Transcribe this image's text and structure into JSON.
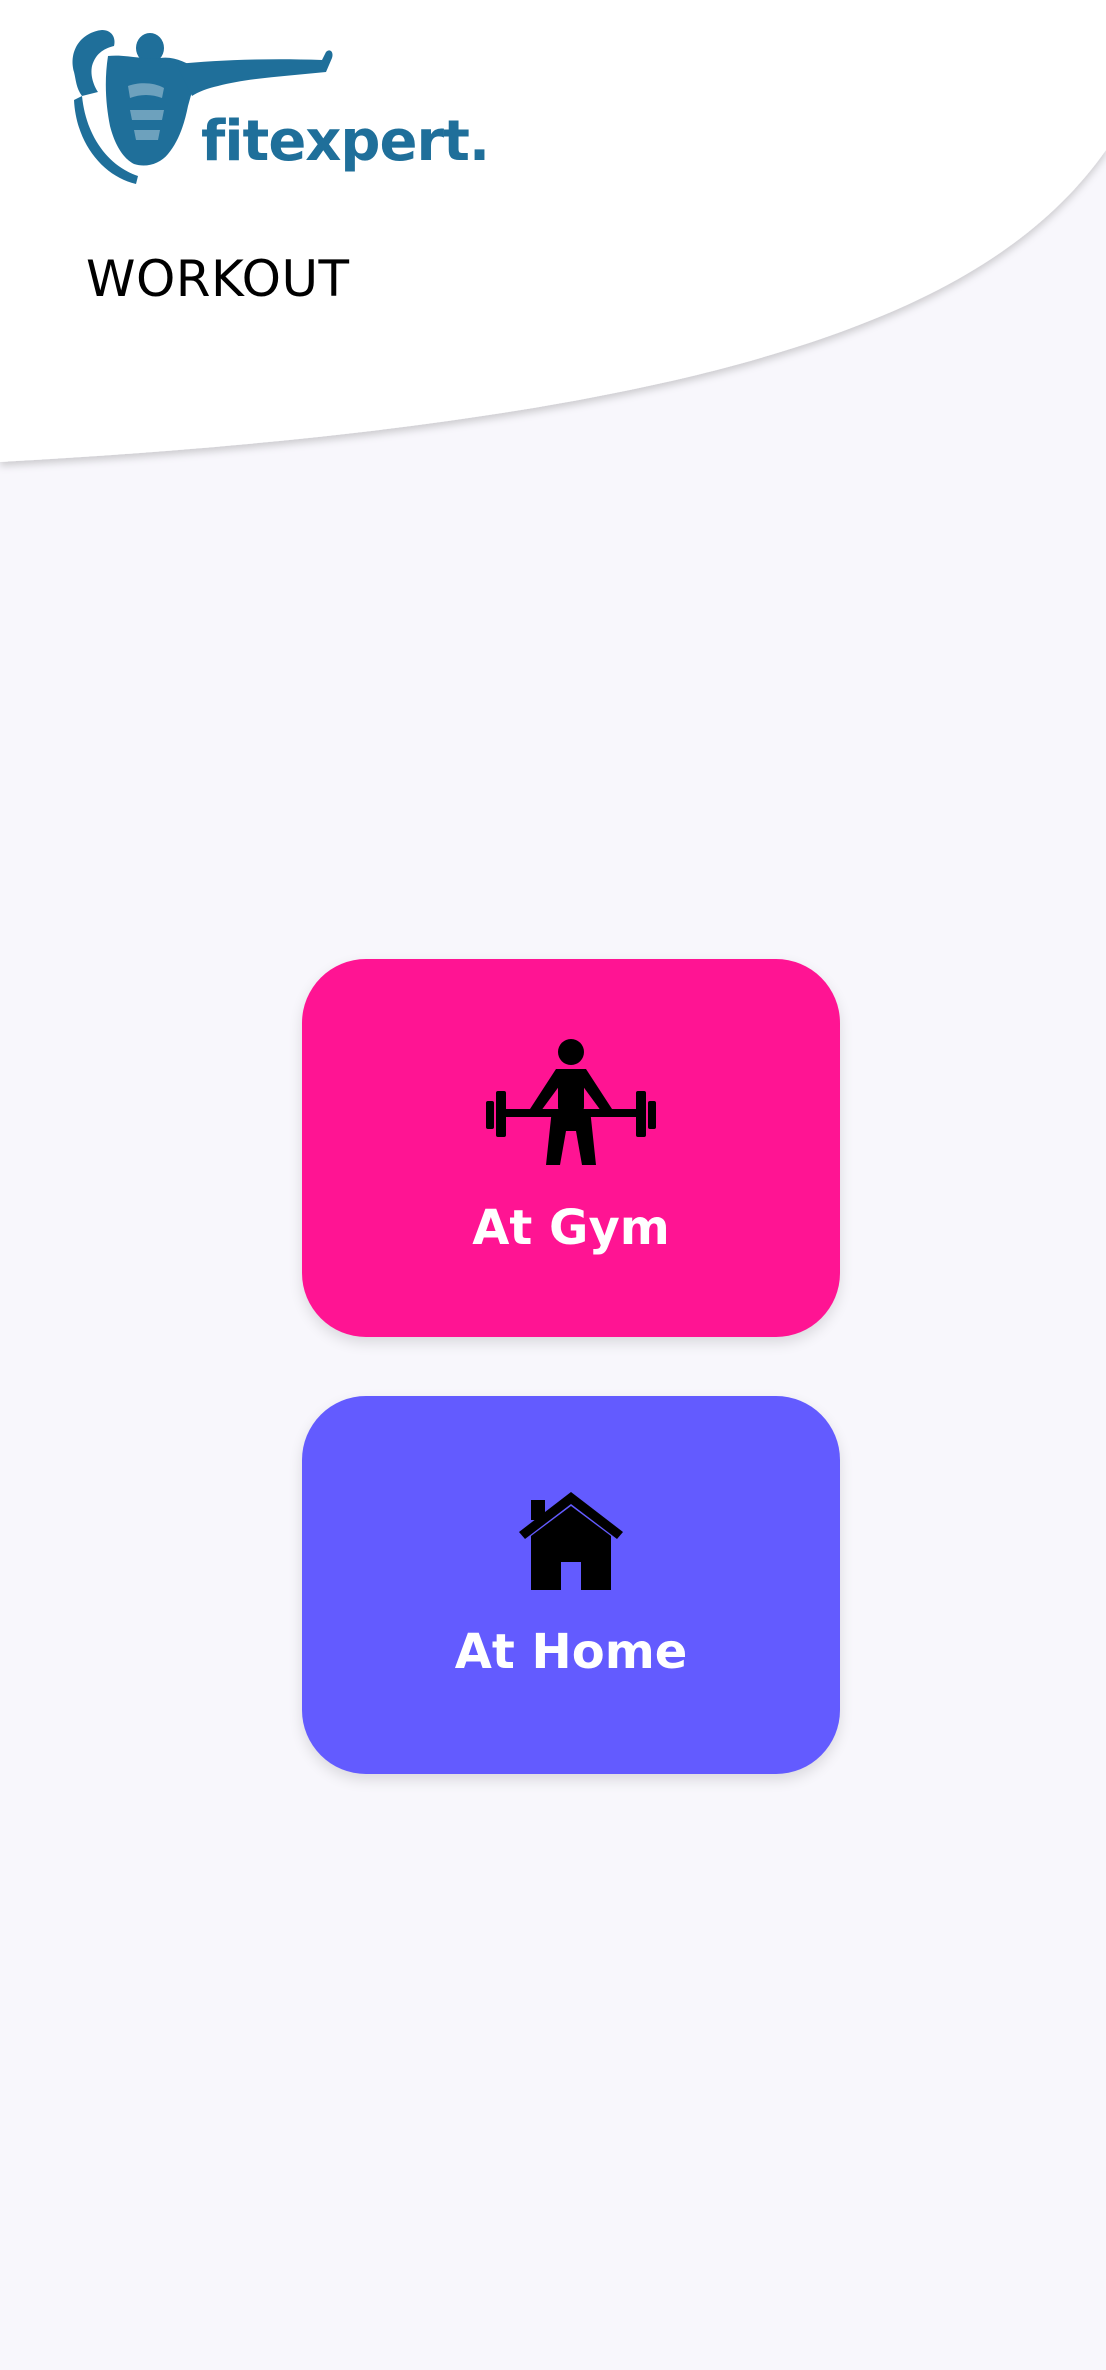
{
  "brand": {
    "name": "fitexpert.",
    "color": "#1f6f9a"
  },
  "header": {
    "title": "WORKOUT"
  },
  "options": [
    {
      "label": "At Gym",
      "icon": "weightlifting-icon",
      "color": "#ff1493"
    },
    {
      "label": "At Home",
      "icon": "house-icon",
      "color": "#635bff"
    }
  ],
  "colors": {
    "background": "#f8f7fc",
    "header_background": "#ffffff"
  }
}
